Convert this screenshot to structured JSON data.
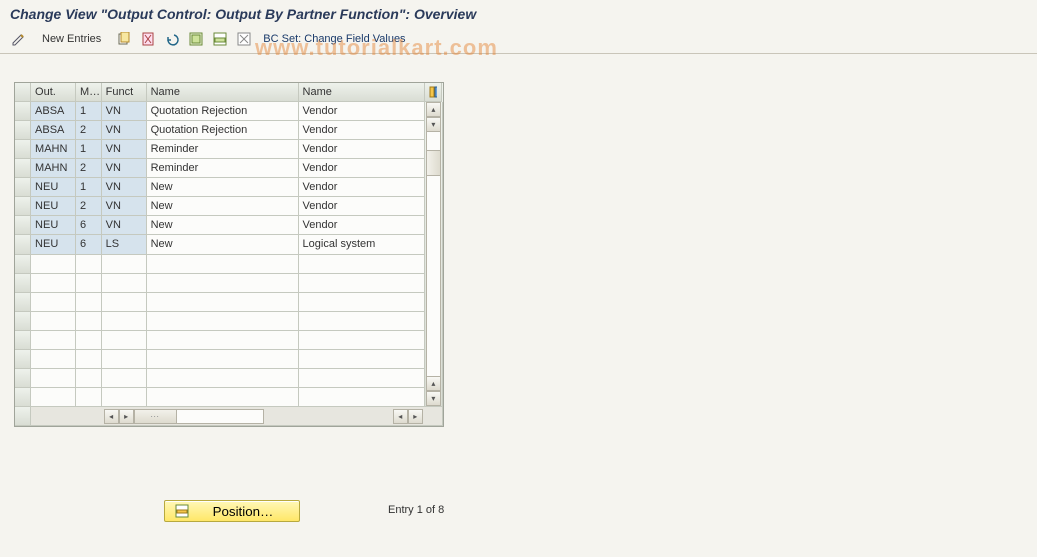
{
  "title": "Change View \"Output Control: Output By Partner Function\": Overview",
  "toolbar": {
    "new_entries": "New Entries",
    "bc_set": "BC Set: Change Field Values"
  },
  "columns": {
    "out": "Out.",
    "m": "M…",
    "funct": "Funct",
    "name1": "Name",
    "name2": "Name"
  },
  "rows": [
    {
      "out": "ABSA",
      "m": "1",
      "funct": "VN",
      "name1": "Quotation Rejection",
      "name2": "Vendor"
    },
    {
      "out": "ABSA",
      "m": "2",
      "funct": "VN",
      "name1": "Quotation Rejection",
      "name2": "Vendor"
    },
    {
      "out": "MAHN",
      "m": "1",
      "funct": "VN",
      "name1": "Reminder",
      "name2": "Vendor"
    },
    {
      "out": "MAHN",
      "m": "2",
      "funct": "VN",
      "name1": "Reminder",
      "name2": "Vendor"
    },
    {
      "out": "NEU",
      "m": "1",
      "funct": "VN",
      "name1": "New",
      "name2": "Vendor"
    },
    {
      "out": "NEU",
      "m": "2",
      "funct": "VN",
      "name1": "New",
      "name2": "Vendor"
    },
    {
      "out": "NEU",
      "m": "6",
      "funct": "VN",
      "name1": "New",
      "name2": "Vendor"
    },
    {
      "out": "NEU",
      "m": "6",
      "funct": "LS",
      "name1": "New",
      "name2": "Logical system"
    }
  ],
  "empty_rows": 8,
  "position_button": "Position…",
  "entry_info": "Entry 1 of 8",
  "watermark": "www.tutorialkart.com"
}
